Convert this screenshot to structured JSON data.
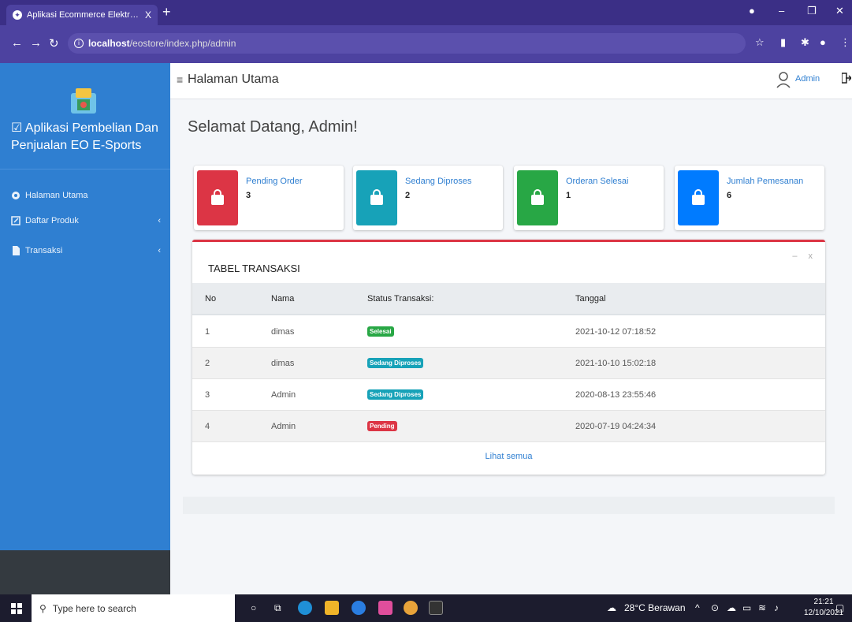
{
  "browser": {
    "tab_title": "Aplikasi Ecommerce Elektronik R",
    "tab_close": "X",
    "new_tab": "+",
    "url_host": "localhost",
    "url_path": "/eostore/index.php/admin"
  },
  "sidebar": {
    "brand": "Aplikasi Pembelian Dan Penjualan EO E-Sports",
    "items": [
      {
        "label": "Halaman Utama",
        "chevron": ""
      },
      {
        "label": "Daftar Produk",
        "chevron": "‹"
      },
      {
        "label": "Transaksi",
        "chevron": "‹"
      }
    ]
  },
  "header": {
    "page_title": "Halaman Utama",
    "user_name": "Admin"
  },
  "main": {
    "welcome": "Selamat Datang, Admin!",
    "cards": [
      {
        "title": "Pending Order",
        "value": "3",
        "color": "#dc3545"
      },
      {
        "title": "Sedang Diproses",
        "value": "2",
        "color": "#17a2b8"
      },
      {
        "title": "Orderan Selesai",
        "value": "1",
        "color": "#28a745"
      },
      {
        "title": "Jumlah Pemesanan",
        "value": "6",
        "color": "#007bff"
      }
    ],
    "table": {
      "title": "TABEL TRANSAKSI",
      "tool_minimize": "–",
      "tool_close": "x",
      "headers": [
        "No",
        "Nama",
        "Status Transaksi:",
        "Tanggal"
      ],
      "rows": [
        {
          "no": "1",
          "nama": "dimas",
          "status": "Selesai",
          "status_color": "#28a745",
          "tanggal": "2021-10-12 07:18:52"
        },
        {
          "no": "2",
          "nama": "dimas",
          "status": "Sedang Diproses",
          "status_color": "#17a2b8",
          "tanggal": "2021-10-10 15:02:18"
        },
        {
          "no": "3",
          "nama": "Admin",
          "status": "Sedang Diproses",
          "status_color": "#17a2b8",
          "tanggal": "2020-08-13 23:55:46"
        },
        {
          "no": "4",
          "nama": "Admin",
          "status": "Pending",
          "status_color": "#dc3545",
          "tanggal": "2020-07-19 04:24:34"
        }
      ],
      "footer_link": "Lihat semua"
    }
  },
  "taskbar": {
    "search_placeholder": "Type here to search",
    "weather": "28°C Berawan",
    "time": "21:21",
    "date": "12/10/2021"
  }
}
